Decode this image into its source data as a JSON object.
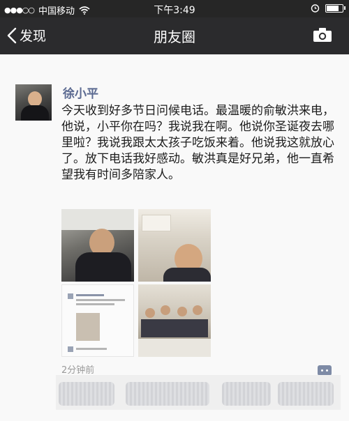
{
  "status_bar": {
    "carrier": "中国移动",
    "time": "下午3:49"
  },
  "nav": {
    "back_label": "发现",
    "title": "朋友圈"
  },
  "post": {
    "author": "徐小平",
    "text": "今天收到好多节日问候电话。最温暖的俞敏洪来电，他说，小平你在吗？我说我在啊。他说你圣诞夜去哪里啦？我说我跟太太孩子吃饭来着。他说我这就放心了。放下电话我好感动。敏洪真是好兄弟，他一直希望我有时间多陪家人。",
    "timestamp": "2分钟前"
  },
  "colors": {
    "nav_bg": "#2b2b2d",
    "author_name": "#5b6a91",
    "more_button": "#7e8ba6"
  },
  "icons": [
    "back-chevron-icon",
    "camera-icon",
    "wifi-icon",
    "alarm-icon",
    "battery-icon",
    "more-comment-icon"
  ]
}
